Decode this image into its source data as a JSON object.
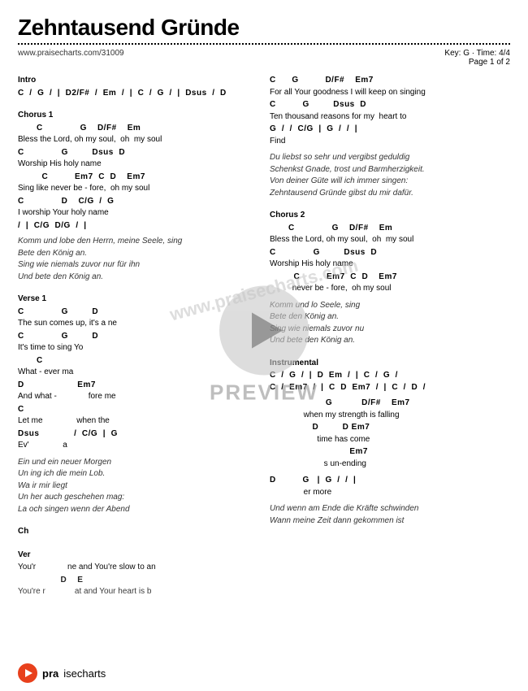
{
  "title": "Zehntausend Gründe",
  "website": "www.praisecharts.com/31009",
  "key_time": "Key: G  ·  Time: 4/4",
  "page_info": "Page 1 of 2",
  "sections": {
    "intro": {
      "label": "Intro",
      "lines": [
        {
          "type": "chord",
          "text": "C  /  G  /  |  D2/F#  /  Em  /  |  C  /  G  /  |  Dsus  /  D"
        }
      ]
    },
    "chorus1": {
      "label": "Chorus 1",
      "lines": [
        {
          "type": "chord",
          "text": "       C              G    D/F#    Em"
        },
        {
          "type": "lyric",
          "text": "Bless the Lord, oh my soul,  oh  my soul"
        },
        {
          "type": "chord",
          "text": "C              G         Dsus  D"
        },
        {
          "type": "lyric",
          "text": "Worship His holy name"
        },
        {
          "type": "chord",
          "text": "         C          Em7  C  D    Em7"
        },
        {
          "type": "lyric",
          "text": "Sing like never be - fore,  oh my soul"
        },
        {
          "type": "chord",
          "text": "C              D    C/G  /  G"
        },
        {
          "type": "lyric",
          "text": "I worship Your holy name"
        },
        {
          "type": "chord",
          "text": "/  |  C/G  D/G  /  |"
        },
        {
          "type": "spacer"
        }
      ]
    },
    "chorus1_german": {
      "lines": [
        {
          "type": "italic",
          "text": "Komm und lobe den Herrn, meine Seele, sing"
        },
        {
          "type": "italic",
          "text": "Bete den König an."
        },
        {
          "type": "italic",
          "text": "Sing wie niemals zuvor nur für ihn"
        },
        {
          "type": "italic",
          "text": "Und bete den König an."
        },
        {
          "type": "spacer"
        }
      ]
    },
    "verse1": {
      "label": "Verse 1",
      "lines": [
        {
          "type": "chord",
          "text": "C              G         D"
        },
        {
          "type": "lyric",
          "text": "The sun comes up, it's a ne"
        },
        {
          "type": "chord",
          "text": "C              G         D"
        },
        {
          "type": "lyric",
          "text": "It's time to sing Yo"
        },
        {
          "type": "chord",
          "text": "       C"
        },
        {
          "type": "lyric",
          "text": "What - ever ma"
        },
        {
          "type": "chord",
          "text": "D                    Em7"
        },
        {
          "type": "lyric",
          "text": "And what -              fore me"
        },
        {
          "type": "chord",
          "text": "C"
        },
        {
          "type": "lyric",
          "text": "Let me               when the"
        },
        {
          "type": "chord",
          "text": "Dsus             /  C/G  |  G"
        },
        {
          "type": "lyric",
          "text": "Ev'               a"
        },
        {
          "type": "spacer"
        }
      ]
    },
    "verse1_german": {
      "lines": [
        {
          "type": "italic",
          "text": "Ein                und ein neuer Morgen"
        },
        {
          "type": "italic",
          "text": "Un              ing ich die mein Lob."
        },
        {
          "type": "italic",
          "text": "Wa               ir mir liegt"
        },
        {
          "type": "italic",
          "text": "Un             her auch geschehen mag:"
        },
        {
          "type": "italic",
          "text": "La             och singen wenn der Abend"
        },
        {
          "type": "spacer"
        }
      ]
    },
    "chorus_label": {
      "label": "Ch"
    },
    "verse_label": {
      "label": "Ver"
    },
    "you_lines": [
      {
        "type": "lyric",
        "text": "You'r              ne and You're slow to an"
      },
      {
        "type": "chord",
        "text": "                D    E"
      },
      {
        "type": "lyric",
        "text": "You're r             at and Your heart is b"
      }
    ]
  },
  "right_col": {
    "top_section": {
      "lines": [
        {
          "type": "chord",
          "text": "C      G          D/F#    Em7"
        },
        {
          "type": "lyric",
          "text": "For all Your goodness I will keep on singing"
        },
        {
          "type": "chord",
          "text": "C          G         Dsus  D"
        },
        {
          "type": "lyric",
          "text": "Ten thousand reasons for my  heart to"
        },
        {
          "type": "chord",
          "text": "G  /  /  C/G  |  G  /  /  |"
        },
        {
          "type": "lyric",
          "text": "Find"
        },
        {
          "type": "spacer"
        }
      ]
    },
    "german_block": {
      "lines": [
        {
          "type": "italic",
          "text": "Du liebst so sehr und vergibst geduldig"
        },
        {
          "type": "italic",
          "text": "Schenkst Gnade, trost und Barmherzigkeit."
        },
        {
          "type": "italic",
          "text": "Von deiner Güte will ich immer singen:"
        },
        {
          "type": "italic",
          "text": "Zehntausend Gründe gibst du mir dafür."
        },
        {
          "type": "spacer"
        }
      ]
    },
    "chorus2": {
      "label": "Chorus 2",
      "lines": [
        {
          "type": "chord",
          "text": "       C              G    D/F#    Em"
        },
        {
          "type": "lyric",
          "text": "Bless the Lord, oh my soul,  oh  my soul"
        },
        {
          "type": "chord",
          "text": "C              G         Dsus  D"
        },
        {
          "type": "lyric",
          "text": "Worship His holy name"
        },
        {
          "type": "chord",
          "text": "         C          Em7  C  D    Em7"
        },
        {
          "type": "lyric",
          "text": "          never be - fore,  oh my soul"
        },
        {
          "type": "spacer"
        }
      ]
    },
    "chorus2_german": {
      "lines": [
        {
          "type": "italic",
          "text": "Komm und lo               Seele, sing"
        },
        {
          "type": "italic",
          "text": "Bete den König an."
        },
        {
          "type": "italic",
          "text": "Sing wie niemals zuvor nu"
        },
        {
          "type": "italic",
          "text": "Und bete den König an."
        },
        {
          "type": "spacer"
        }
      ]
    },
    "instrumental": {
      "label": "Instrumental",
      "lines": [
        {
          "type": "chord",
          "text": "C  /  G  /  |  D  Em  /  |  C  /  G  /"
        },
        {
          "type": "chord",
          "text": "C  /  Em7  /  |  C  D  Em7  /  |  C  /  D  /"
        }
      ]
    },
    "verse3_lines": [
      {
        "type": "chord",
        "text": "                     G           D/F#    Em7"
      },
      {
        "type": "lyric",
        "text": "               when my strength is falling"
      },
      {
        "type": "chord",
        "text": "                D         D Em7"
      },
      {
        "type": "lyric",
        "text": "                     time has come"
      },
      {
        "type": "chord",
        "text": "                              Em7"
      },
      {
        "type": "lyric",
        "text": "                        s un-ending"
      }
    ],
    "outro_chord": {
      "type": "chord",
      "text": "D          G   |  G  /  /  |"
    },
    "outro_lyric": {
      "type": "lyric",
      "text": "               er more"
    },
    "german2": [
      {
        "type": "italic",
        "text": "Und wenn am Ende die Kräfte schwinden"
      },
      {
        "type": "italic",
        "text": "Wann meine Zeit dann gekommen ist"
      }
    ]
  },
  "preview_text": "PREVIEW",
  "watermark_url": "www.praisecharts.com",
  "footer": {
    "logo_alt": "PraiseCharts logo",
    "text_bold": "pra",
    "text_normal": "isecharts"
  }
}
